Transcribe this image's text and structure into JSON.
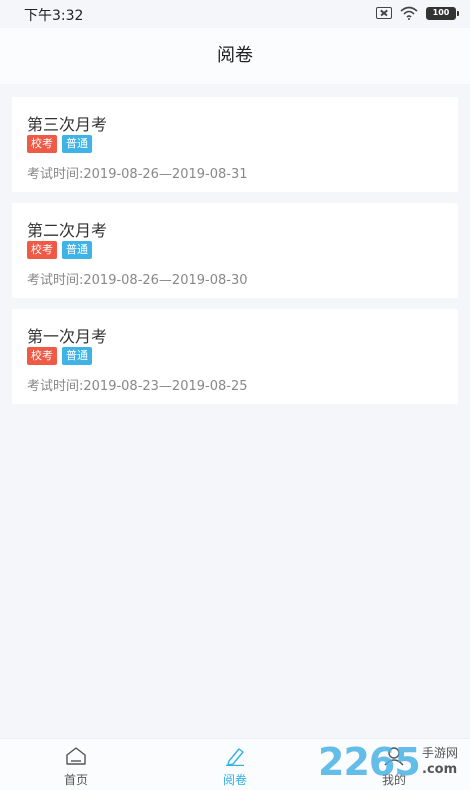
{
  "status_bar": {
    "time": "下午3:32",
    "battery": "100"
  },
  "header": {
    "title": "阅卷"
  },
  "exams": [
    {
      "title": "第三次月考",
      "tags": [
        "校考",
        "普通"
      ],
      "time": "考试时间:2019-08-26—2019-08-31"
    },
    {
      "title": "第二次月考",
      "tags": [
        "校考",
        "普通"
      ],
      "time": "考试时间:2019-08-26—2019-08-30"
    },
    {
      "title": "第一次月考",
      "tags": [
        "校考",
        "普通"
      ],
      "time": "考试时间:2019-08-23—2019-08-25"
    }
  ],
  "tabbar": {
    "items": [
      {
        "label": "首页",
        "icon": "home-icon"
      },
      {
        "label": "阅卷",
        "icon": "pencil-icon",
        "active": true
      },
      {
        "label": "我的",
        "icon": "user-icon"
      }
    ]
  },
  "watermark": {
    "number": "2265",
    "cn": "手游网",
    "domain": ".com"
  },
  "colors": {
    "accent": "#2fb0e8",
    "tag_red": "#ee5a46",
    "tag_blue": "#3fb3e6"
  }
}
